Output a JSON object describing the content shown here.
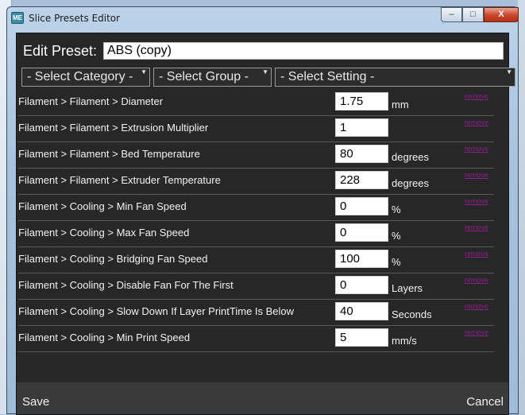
{
  "window": {
    "title": "Slice Presets Editor",
    "icon_text": "ME",
    "buttons": {
      "minimize": "–",
      "maximize": "□",
      "close": "X"
    }
  },
  "editor": {
    "edit_label": "Edit Preset:",
    "preset_name": "ABS (copy)"
  },
  "filters": {
    "category": "- Select Category -",
    "group": "- Select Group -",
    "setting": "- Select Setting -"
  },
  "settings": [
    {
      "name": "Filament > Filament > Diameter",
      "value": "1.75",
      "unit": "mm",
      "remove": "remove"
    },
    {
      "name": "Filament > Filament > Extrusion Multiplier",
      "value": "1",
      "unit": "",
      "remove": "remove"
    },
    {
      "name": "Filament > Filament > Bed Temperature",
      "value": "80",
      "unit": "degrees",
      "remove": "remove"
    },
    {
      "name": "Filament > Filament > Extruder Temperature",
      "value": "228",
      "unit": "degrees",
      "remove": "remove"
    },
    {
      "name": "Filament > Cooling > Min Fan Speed",
      "value": "0",
      "unit": "%",
      "remove": "remove"
    },
    {
      "name": "Filament > Cooling > Max Fan Speed",
      "value": "0",
      "unit": "%",
      "remove": "remove"
    },
    {
      "name": "Filament > Cooling > Bridging Fan Speed",
      "value": "100",
      "unit": "%",
      "remove": "remove"
    },
    {
      "name": "Filament > Cooling > Disable Fan For The First",
      "value": "0",
      "unit": "Layers",
      "remove": "remove"
    },
    {
      "name": "Filament > Cooling > Slow Down If Layer PrintTime Is Below",
      "value": "40",
      "unit": "Seconds",
      "remove": "remove"
    },
    {
      "name": "Filament > Cooling > Min Print Speed",
      "value": "5",
      "unit": "mm/s",
      "remove": "remove"
    }
  ],
  "footer": {
    "save": "Save",
    "cancel": "Cancel"
  },
  "colors": {
    "panel_bg": "#272727",
    "footer_bg": "#3a3a3a",
    "remove_link": "#8c1f8a"
  }
}
